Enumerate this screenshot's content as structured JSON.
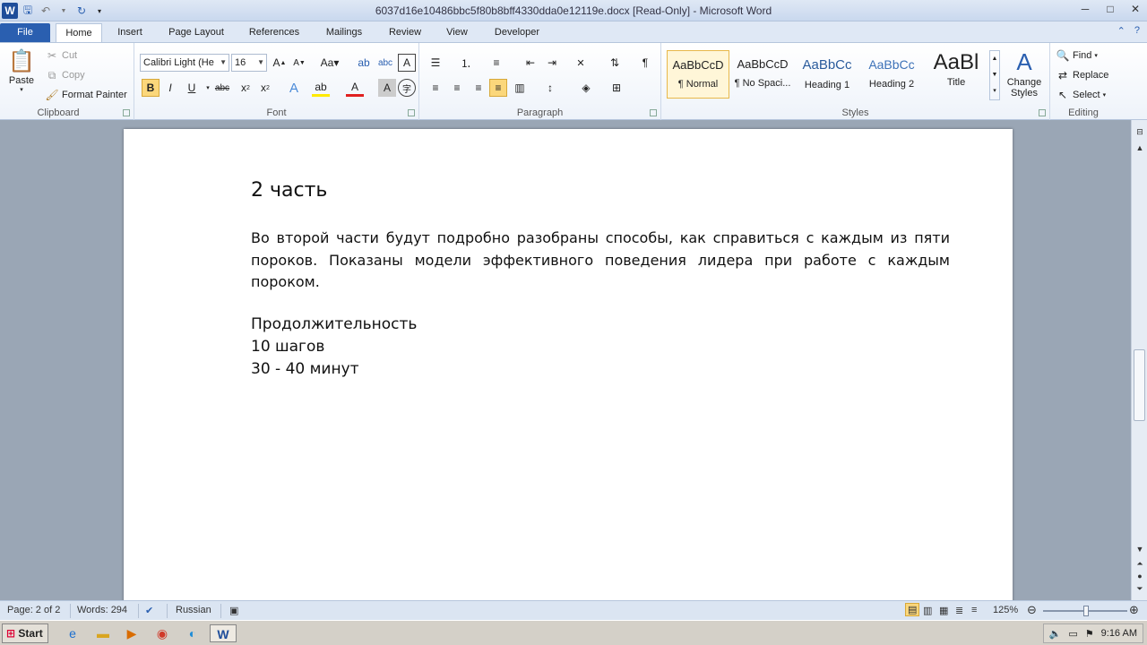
{
  "window": {
    "title": "6037d16e10486bbc5f80b8bff4330dda0e12119e.docx [Read-Only]  -  Microsoft Word",
    "controls": [
      "─",
      "□",
      "✕"
    ]
  },
  "tabs": [
    "File",
    "Home",
    "Insert",
    "Page Layout",
    "References",
    "Mailings",
    "Review",
    "View",
    "Developer"
  ],
  "clipboard": {
    "label": "Clipboard",
    "paste": "Paste",
    "cut": "Cut",
    "copy": "Copy",
    "format_painter": "Format Painter"
  },
  "font": {
    "label": "Font",
    "family": "Calibri Light (He",
    "size": "16"
  },
  "paragraph": {
    "label": "Paragraph"
  },
  "styles": {
    "label": "Styles",
    "items": [
      {
        "sample": "AaBbCcD",
        "name": "¶ Normal"
      },
      {
        "sample": "AaBbCcD",
        "name": "¶ No Spaci..."
      },
      {
        "sample": "AaBbCc",
        "name": "Heading 1"
      },
      {
        "sample": "AaBbCc",
        "name": "Heading 2"
      },
      {
        "sample": "AaBl",
        "name": "Title"
      }
    ],
    "change_styles": "Change Styles"
  },
  "editing": {
    "label": "Editing",
    "find": "Find",
    "replace": "Replace",
    "select": "Select"
  },
  "document": {
    "heading": "2 часть",
    "paragraph": "Во второй части будут подробно разобраны способы, как справиться с каждым из пяти пороков. Показаны модели эффективного поведения лидера при работе с каждым пороком.",
    "details": [
      "Продолжительность",
      "10 шагов",
      "30 - 40 минут"
    ]
  },
  "status": {
    "page": "Page: 2 of 2",
    "words": "Words: 294",
    "language": "Russian",
    "zoom": "125%"
  },
  "taskbar": {
    "start": "Start",
    "time": "9:16 AM"
  }
}
